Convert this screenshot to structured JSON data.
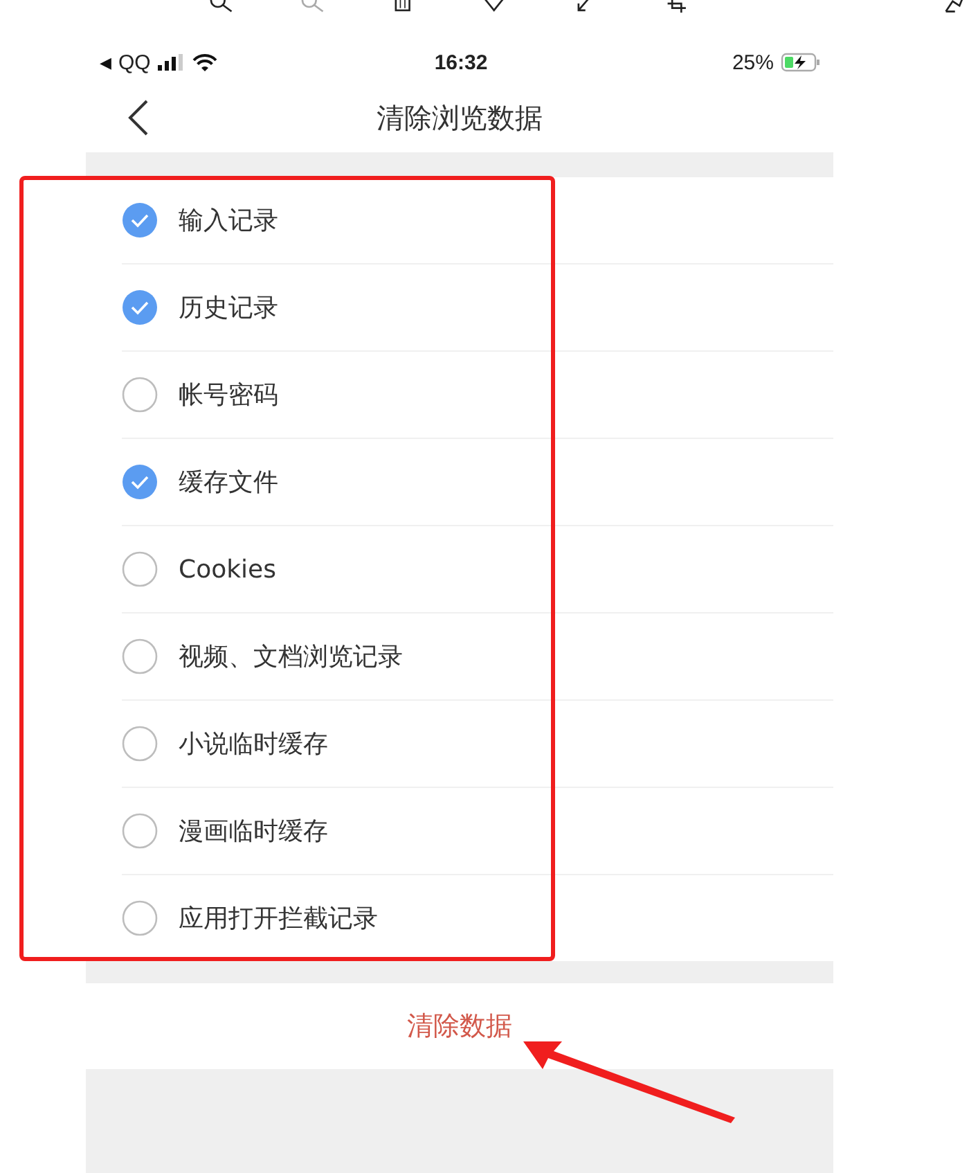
{
  "status_bar": {
    "back_glyph": "◀",
    "back_app": "QQ",
    "time": "16:32",
    "battery": "25%"
  },
  "nav": {
    "title": "清除浏览数据"
  },
  "options": [
    {
      "label": "输入记录",
      "checked": true
    },
    {
      "label": "历史记录",
      "checked": true
    },
    {
      "label": "帐号密码",
      "checked": false
    },
    {
      "label": "缓存文件",
      "checked": true
    },
    {
      "label": "Cookies",
      "checked": false
    },
    {
      "label": "视频、文档浏览记录",
      "checked": false
    },
    {
      "label": "小说临时缓存",
      "checked": false
    },
    {
      "label": "漫画临时缓存",
      "checked": false
    },
    {
      "label": "应用打开拦截记录",
      "checked": false
    }
  ],
  "clear_button": {
    "label": "清除数据"
  }
}
